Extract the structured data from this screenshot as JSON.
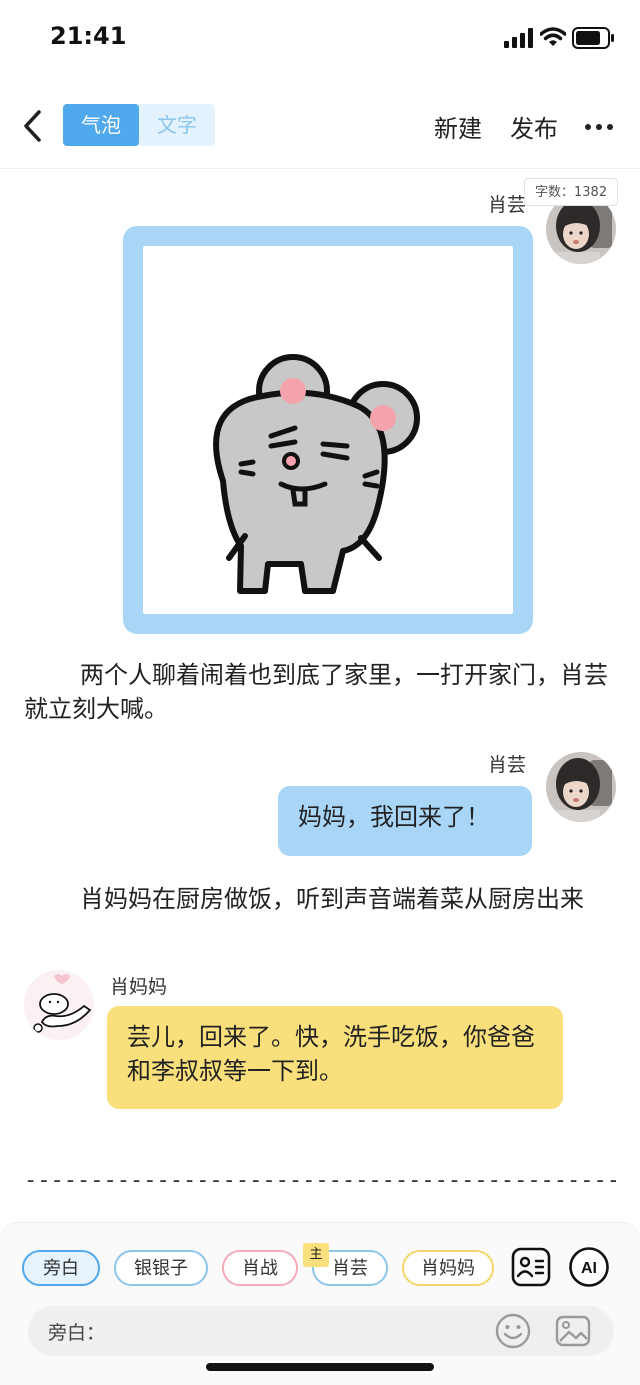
{
  "status": {
    "time": "21:41"
  },
  "nav": {
    "seg_bubble": "气泡",
    "seg_text": "文字",
    "new": "新建",
    "publish": "发布"
  },
  "word_count": "字数：1382",
  "messages": {
    "m1_name": "肖芸",
    "narr1": "两个人聊着闹着也到底了家里，一打开家门，肖芸就立刻大喊。",
    "m2_name": "肖芸",
    "m2_text": "妈妈，我回来了！",
    "narr2": "肖妈妈在厨房做饭，听到声音端着菜从厨房出来",
    "m3_name": "肖妈妈",
    "m3_text": "芸儿，回来了。快，洗手吃饭，你爸爸和李叔叔等一下到。"
  },
  "separator": "-----------------------------------------------------",
  "roles": {
    "narrator": "旁白",
    "r2": "银银子",
    "r3": "肖战",
    "r4": "肖芸",
    "r4_badge": "主",
    "r5": "肖妈妈"
  },
  "input": {
    "label": "旁白："
  },
  "colors": {
    "accent": "#4fa9ec",
    "bubble_blue": "#a9d6f6",
    "bubble_yellow": "#f9e07c"
  }
}
